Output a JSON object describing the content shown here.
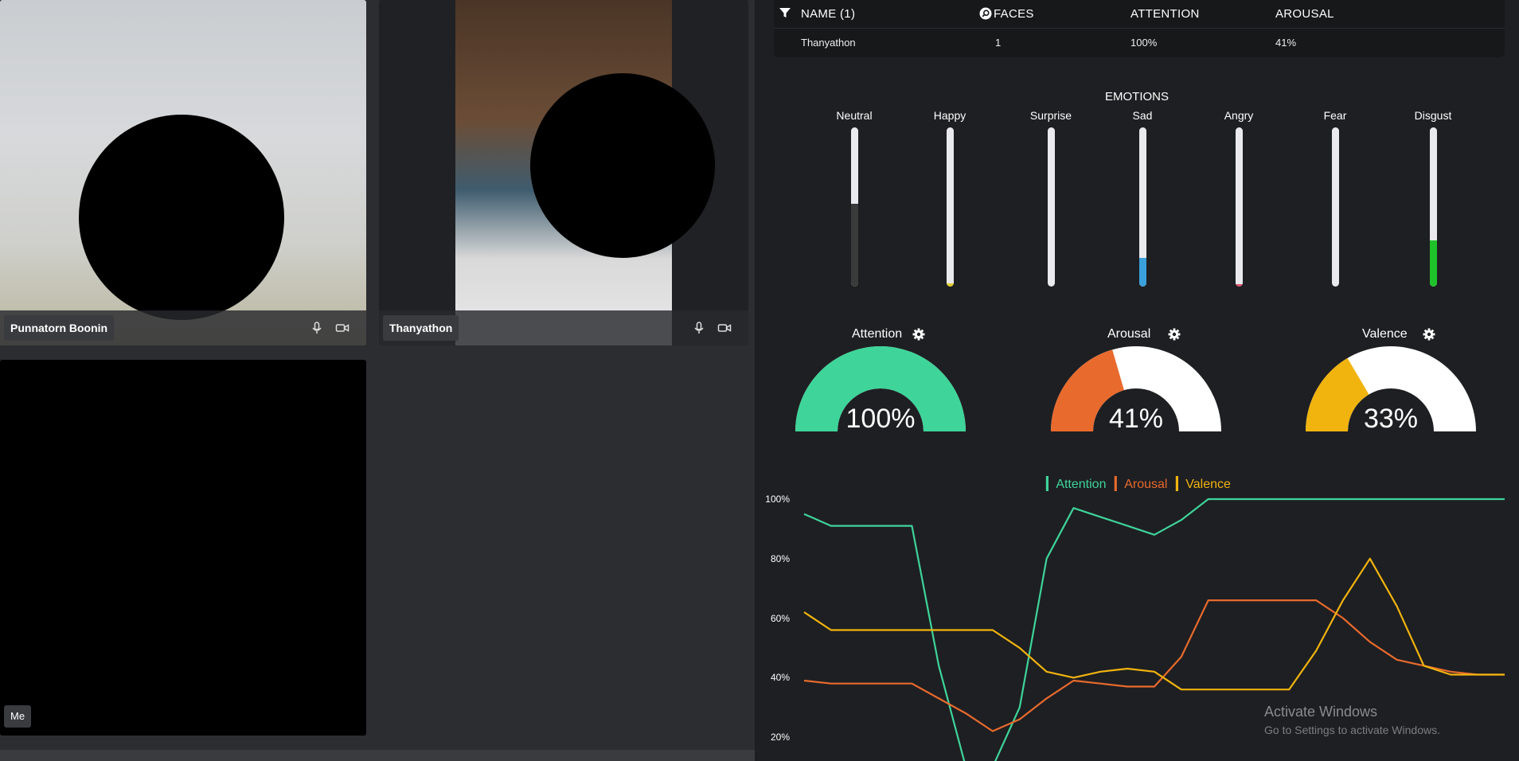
{
  "participants": [
    {
      "name": "Punnatorn Boonin"
    },
    {
      "name": "Thanyathon"
    },
    {
      "name": "Me"
    }
  ],
  "table": {
    "headers": [
      "NAME (1)",
      "FACES",
      "ATTENTION",
      "AROUSAL"
    ],
    "rows": [
      {
        "name": "Thanyathon",
        "faces": "1",
        "attention": "100%",
        "arousal": "41%"
      }
    ]
  },
  "emotions": {
    "title": "EMOTIONS",
    "items": [
      {
        "label": "Neutral",
        "level": 0.52,
        "color": "#3a3a3a"
      },
      {
        "label": "Happy",
        "level": 0.02,
        "color": "#e2cc2a"
      },
      {
        "label": "Surprise",
        "level": 0.0,
        "color": "#cccccc"
      },
      {
        "label": "Sad",
        "level": 0.18,
        "color": "#3aa0dc"
      },
      {
        "label": "Angry",
        "level": 0.01,
        "color": "#e0506e"
      },
      {
        "label": "Fear",
        "level": 0.0,
        "color": "#cccccc"
      },
      {
        "label": "Disgust",
        "level": 0.29,
        "color": "#1fc22a"
      }
    ]
  },
  "gauges": [
    {
      "label": "Attention",
      "value": 100,
      "display": "100%",
      "color": "#3ed49a"
    },
    {
      "label": "Arousal",
      "value": 41,
      "display": "41%",
      "color": "#e86a2d"
    },
    {
      "label": "Valence",
      "value": 33,
      "display": "33%",
      "color": "#f1b40f"
    }
  ],
  "chart_data": {
    "type": "line",
    "legend": [
      "Attention",
      "Arousal",
      "Valence"
    ],
    "yticks": [
      "100%",
      "80%",
      "60%",
      "40%",
      "20%"
    ],
    "ylim": [
      20,
      100
    ],
    "x": [
      0,
      1,
      2,
      3,
      4,
      5,
      6,
      7,
      8,
      9,
      10,
      11,
      12,
      13,
      14,
      15,
      16,
      17,
      18,
      19,
      20,
      21,
      22,
      23,
      24,
      25,
      26
    ],
    "series": [
      {
        "name": "Attention",
        "color": "#3ed49a",
        "values": [
          95,
          91,
          91,
          91,
          91,
          44,
          10,
          10,
          30,
          80,
          97,
          94,
          91,
          88,
          93,
          100,
          100,
          100,
          100,
          100,
          100,
          100,
          100,
          100,
          100,
          100,
          100
        ]
      },
      {
        "name": "Arousal",
        "color": "#e86a2d",
        "values": [
          39,
          38,
          38,
          38,
          38,
          33,
          28,
          22,
          26,
          33,
          39,
          38,
          37,
          37,
          47,
          66,
          66,
          66,
          66,
          66,
          60,
          52,
          46,
          44,
          42,
          41,
          41
        ]
      },
      {
        "name": "Valence",
        "color": "#f1b40f",
        "values": [
          62,
          56,
          56,
          56,
          56,
          56,
          56,
          56,
          50,
          42,
          40,
          42,
          43,
          42,
          36,
          36,
          36,
          36,
          36,
          49,
          66,
          80,
          64,
          44,
          41,
          41,
          41
        ]
      }
    ]
  },
  "watermark": {
    "line1": "Activate Windows",
    "line2": "Go to Settings to activate Windows."
  }
}
